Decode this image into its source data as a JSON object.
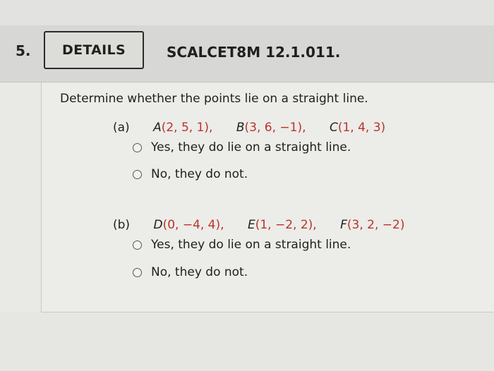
{
  "question_number": "5.",
  "details_label": "DETAILS",
  "course_code": "SCALCET8M 12.1.011.",
  "prompt": "Determine whether the points lie on a straight line.",
  "parts": [
    {
      "label": "(a)",
      "points": [
        {
          "name": "A",
          "coords": "(2, 5, 1),"
        },
        {
          "name": "B",
          "coords": "(3, 6, −1),"
        },
        {
          "name": "C",
          "coords": "(1, 4, 3)"
        }
      ],
      "options": [
        "Yes, they do lie on a straight line.",
        "No, they do not."
      ]
    },
    {
      "label": "(b)",
      "points": [
        {
          "name": "D",
          "coords": "(0, −4, 4),"
        },
        {
          "name": "E",
          "coords": "(1, −2, 2),"
        },
        {
          "name": "F",
          "coords": "(3, 2, −2)"
        }
      ],
      "options": [
        "Yes, they do lie on a straight line.",
        "No, they do not."
      ]
    }
  ]
}
